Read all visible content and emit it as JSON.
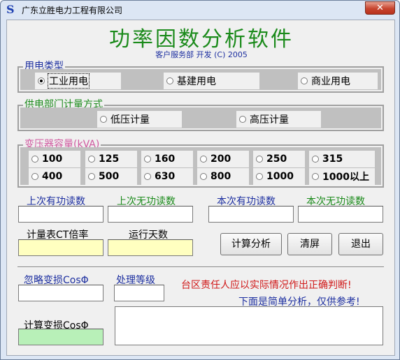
{
  "window": {
    "title": "广东立胜电力工程有限公司",
    "close_label": "✕",
    "app_icon": "S"
  },
  "header": {
    "title": "功率因数分析软件",
    "credit": "客户服务部 开发 (C) 2005"
  },
  "groups": {
    "electricity_type": {
      "title": "用电类型",
      "options": [
        "工业用电",
        "基建用电",
        "商业用电"
      ],
      "selected": "工业用电"
    },
    "metering": {
      "title": "供电部门计量方式",
      "options": [
        "低压计量",
        "高压计量"
      ],
      "selected": ""
    },
    "transformer": {
      "title": "变压器容量(kVA)",
      "options": [
        "100",
        "125",
        "160",
        "200",
        "250",
        "315",
        "400",
        "500",
        "630",
        "800",
        "1000",
        "1000以上"
      ],
      "selected": ""
    }
  },
  "readings": {
    "last_active_label": "上次有功读数",
    "last_reactive_label": "上次无功读数",
    "current_active_label": "本次有功读数",
    "current_reactive_label": "本次无功读数",
    "last_active_value": "",
    "last_reactive_value": "",
    "current_active_value": "",
    "current_reactive_value": ""
  },
  "params": {
    "ct_ratio_label": "计量表CT倍率",
    "run_days_label": "运行天数",
    "ct_ratio_value": "",
    "run_days_value": ""
  },
  "buttons": {
    "calculate": "计算分析",
    "clear": "清屏",
    "exit": "退出"
  },
  "results": {
    "ignore_loss_label": "忽略变损CosΦ",
    "level_label": "处理等级",
    "calc_loss_label": "计算变损CosΦ",
    "ignore_loss_value": "",
    "level_value": "",
    "calc_loss_value": "",
    "warning": "台区责任人应以实际情况作出正确判断!",
    "note": "下面是简单分析，仅供参考!",
    "analysis_text": ""
  },
  "colors": {
    "title_green": "#1a8a1a",
    "label_blue": "#1d2fa0",
    "warning_red": "#d01818",
    "group_pink": "#d05aa0",
    "input_yellow": "#ffffc0",
    "input_green": "#b8f0b8"
  }
}
